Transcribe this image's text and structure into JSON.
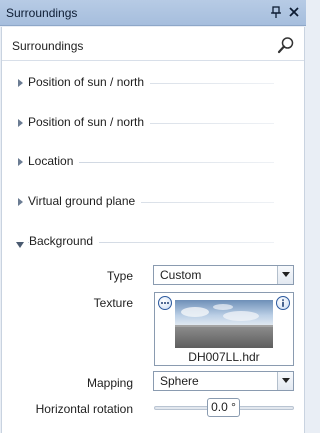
{
  "window": {
    "title": "Surroundings"
  },
  "panel": {
    "header": "Surroundings"
  },
  "sections": [
    {
      "label": "Position of sun / north",
      "expanded": false
    },
    {
      "label": "Position of sun / north",
      "expanded": false
    },
    {
      "label": "Location",
      "expanded": false
    },
    {
      "label": "Virtual ground plane",
      "expanded": false
    },
    {
      "label": "Background",
      "expanded": true
    }
  ],
  "background": {
    "type_label": "Type",
    "type_value": "Custom",
    "texture_label": "Texture",
    "texture_file": "DH007LL.hdr",
    "mapping_label": "Mapping",
    "mapping_value": "Sphere",
    "rotation_label": "Horizontal rotation",
    "rotation_value": "0.0 °"
  },
  "icons": {
    "pin": "pin-icon",
    "close": "close-icon",
    "search": "search-icon",
    "expand": "triangle-right-icon",
    "collapse": "triangle-down-icon",
    "more": "ellipsis-icon",
    "info": "info-icon"
  }
}
